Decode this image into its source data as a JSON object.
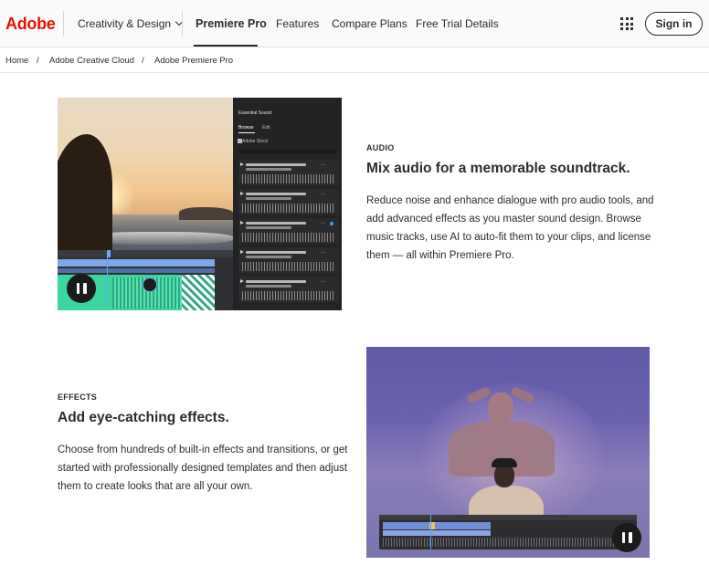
{
  "nav": {
    "logo_text": "Adobe",
    "creativity": "Creativity & Design",
    "premiere": "Premiere Pro",
    "features": "Features",
    "compare": "Compare Plans",
    "trial": "Free Trial Details",
    "signin": "Sign in",
    "brand_color": "#eb1000"
  },
  "breadcrumb": {
    "home": "Home",
    "sep": "/",
    "cc": "Adobe Creative Cloud",
    "current": "Adobe Premiere Pro"
  },
  "audio_section": {
    "eyebrow": "AUDIO",
    "heading": "Mix audio for a memorable soundtrack.",
    "body": "Reduce noise and enhance dialogue with pro audio tools, and add advanced effects as you master sound design. Browse music tracks, use AI to auto-fit them to your clips, and license them — all within Premiere Pro.",
    "panel": {
      "title": "Essential Sound",
      "tab_browse": "Browse",
      "tab_edit": "Edit",
      "stock": "Adobe Stock",
      "more": "···"
    }
  },
  "effects_section": {
    "eyebrow": "EFFECTS",
    "heading": "Add eye-catching effects.",
    "body": "Choose from hundreds of built-in effects and transitions, or get started with professionally designed templates and then adjust them to create looks that are all your own."
  }
}
